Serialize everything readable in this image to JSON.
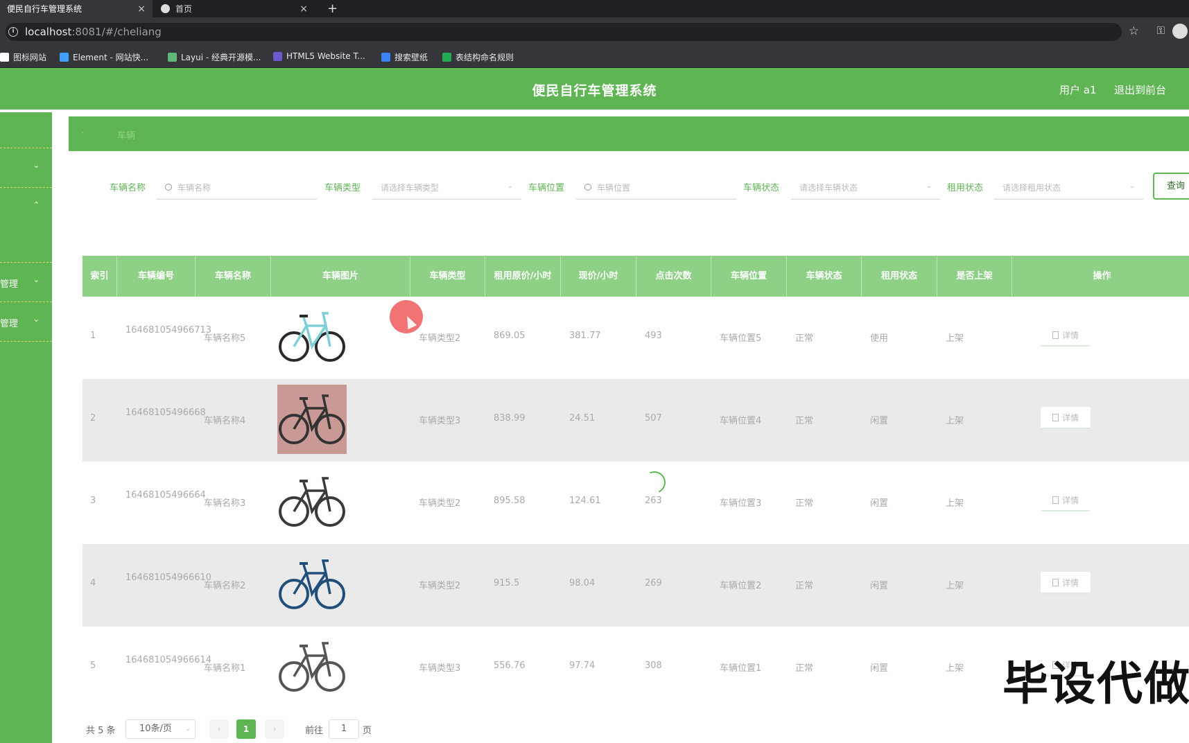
{
  "browser": {
    "tabs": [
      {
        "title": "便民自行车管理系统",
        "active": true
      },
      {
        "title": "首页",
        "active": false
      }
    ],
    "new_tab": "+",
    "url_host": "localhost",
    "url_rest": ":8081/#/cheliang",
    "bookmarks": [
      {
        "label": "图标网站",
        "icon_color": "#ffffff"
      },
      {
        "label": "Element - 网站快...",
        "icon_color": "#409eff"
      },
      {
        "label": "Layui - 经典开源模...",
        "icon_color": "#5fb878"
      },
      {
        "label": "HTML5 Website T...",
        "icon_color": "#6a5acd"
      },
      {
        "label": "搜索壁纸",
        "icon_color": "#3b82f6"
      },
      {
        "label": "表结构命名规则",
        "icon_color": "#22aa55"
      }
    ]
  },
  "header": {
    "title": "便民自行车管理系统",
    "user": "用户 a1",
    "logout": "退出到前台"
  },
  "sidebar": {
    "items": [
      {
        "label": "",
        "chevron": "⌄"
      },
      {
        "label": "",
        "chevron": "⌃"
      },
      {
        "label": "管理",
        "chevron": "⌄"
      },
      {
        "label": "管理",
        "chevron": "⌄"
      }
    ]
  },
  "breadcrumb": {
    "items": [
      "·",
      "车辆"
    ]
  },
  "search": {
    "fields": [
      {
        "label": "车辆名称",
        "placeholder": "车辆名称",
        "type": "input"
      },
      {
        "label": "车辆类型",
        "placeholder": "请选择车辆类型",
        "type": "select"
      },
      {
        "label": "车辆位置",
        "placeholder": "车辆位置",
        "type": "input"
      },
      {
        "label": "车辆状态",
        "placeholder": "请选择车辆状态",
        "type": "select"
      },
      {
        "label": "租用状态",
        "placeholder": "请选择租用状态",
        "type": "select"
      }
    ],
    "query_button": "查询"
  },
  "table": {
    "columns": [
      "索引",
      "车辆编号",
      "车辆名称",
      "车辆图片",
      "车辆类型",
      "租用原价/小时",
      "现价/小时",
      "点击次数",
      "车辆位置",
      "车辆状态",
      "租用状态",
      "是否上架",
      "操作"
    ],
    "detail_label": "详情",
    "rows": [
      {
        "index": "1",
        "code": "164681054966713",
        "name": "车辆名称5",
        "type": "车辆类型2",
        "orig_price": "869.05",
        "price": "381.77",
        "clicks": "493",
        "location": "车辆位置5",
        "status": "正常",
        "rent_status": "使用",
        "listed": "上架",
        "bike_color": "#2a2a2a",
        "accent": "#7ecfd6"
      },
      {
        "index": "2",
        "code": "16468105496668",
        "name": "车辆名称4",
        "type": "车辆类型3",
        "orig_price": "838.99",
        "price": "24.51",
        "clicks": "507",
        "location": "车辆位置4",
        "status": "正常",
        "rent_status": "闲置",
        "listed": "上架",
        "bike_color": "#333333",
        "accent": "#c99a95"
      },
      {
        "index": "3",
        "code": "16468105496664",
        "name": "车辆名称3",
        "type": "车辆类型2",
        "orig_price": "895.58",
        "price": "124.61",
        "clicks": "263",
        "location": "车辆位置3",
        "status": "正常",
        "rent_status": "闲置",
        "listed": "上架",
        "bike_color": "#3a3a3a",
        "accent": "#777777"
      },
      {
        "index": "4",
        "code": "164681054966610",
        "name": "车辆名称2",
        "type": "车辆类型2",
        "orig_price": "915.5",
        "price": "98.04",
        "clicks": "269",
        "location": "车辆位置2",
        "status": "正常",
        "rent_status": "闲置",
        "listed": "上架",
        "bike_color": "#1f4f7a",
        "accent": "#7fa8cc"
      },
      {
        "index": "5",
        "code": "164681054966614",
        "name": "车辆名称1",
        "type": "车辆类型3",
        "orig_price": "556.76",
        "price": "97.74",
        "clicks": "308",
        "location": "车辆位置1",
        "status": "正常",
        "rent_status": "闲置",
        "listed": "上架",
        "bike_color": "#555555",
        "accent": "#bbbbbb"
      }
    ]
  },
  "pagination": {
    "total": "共 5 条",
    "page_size": "10条/页",
    "prev": "‹",
    "pages": [
      "1"
    ],
    "current": "1",
    "next": "›",
    "goto_prefix": "前往",
    "goto_value": "1",
    "goto_suffix": "页"
  },
  "watermark": "毕设代做",
  "colors": {
    "primary": "#5fb554",
    "header_row": "#8ed186"
  }
}
